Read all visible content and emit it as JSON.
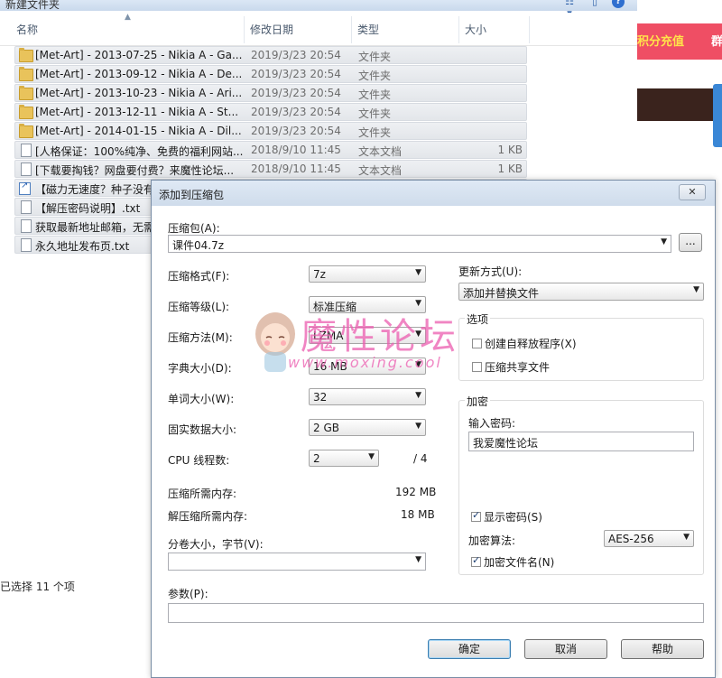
{
  "explorer": {
    "title": "新建文件夹",
    "columns": {
      "name": "名称",
      "date": "修改日期",
      "type": "类型",
      "size": "大小"
    },
    "files": [
      {
        "icon": "folder-icon",
        "name": "[Met-Art] - 2013-07-25 - Nikia A - Ga...",
        "date": "2019/3/23 20:54",
        "type": "文件夹",
        "size": ""
      },
      {
        "icon": "folder-icon",
        "name": "[Met-Art] - 2013-09-12 - Nikia A - De...",
        "date": "2019/3/23 20:54",
        "type": "文件夹",
        "size": ""
      },
      {
        "icon": "folder-icon",
        "name": "[Met-Art] - 2013-10-23 - Nikia A - Ari...",
        "date": "2019/3/23 20:54",
        "type": "文件夹",
        "size": ""
      },
      {
        "icon": "folder-icon",
        "name": "[Met-Art] - 2013-12-11 - Nikia A - St...",
        "date": "2019/3/23 20:54",
        "type": "文件夹",
        "size": ""
      },
      {
        "icon": "folder-icon",
        "name": "[Met-Art] - 2014-01-15 - Nikia A - Dil...",
        "date": "2019/3/23 20:54",
        "type": "文件夹",
        "size": ""
      },
      {
        "icon": "text-file-icon",
        "name": "[人格保证：100%纯净、免费的福利网站...",
        "date": "2018/9/10 11:45",
        "type": "文本文档",
        "size": "1 KB"
      },
      {
        "icon": "text-file-icon",
        "name": "[下载要掏钱？网盘要付费？来魔性论坛...",
        "date": "2018/9/10 11:45",
        "type": "文本文档",
        "size": "1 KB"
      },
      {
        "icon": "shortcut-icon",
        "name": "【磁力无速度？种子没有",
        "date": "",
        "type": "",
        "size": ""
      },
      {
        "icon": "text-file-icon",
        "name": "【解压密码说明】.txt",
        "date": "",
        "type": "",
        "size": ""
      },
      {
        "icon": "text-file-icon",
        "name": "获取最新地址邮箱，无需",
        "date": "",
        "type": "",
        "size": ""
      },
      {
        "icon": "text-file-icon",
        "name": "永久地址发布页.txt",
        "date": "",
        "type": "",
        "size": ""
      }
    ],
    "status": "已选择 11 个项"
  },
  "browser": {
    "banner_text": "积分充值",
    "banner_text2": "群"
  },
  "dialog": {
    "title": "添加到压缩包",
    "close": "✕",
    "archive_label": "压缩包(A):",
    "archive_value": "课件04.7z",
    "browse_label": "...",
    "format_label": "压缩格式(F):",
    "format_value": "7z",
    "level_label": "压缩等级(L):",
    "level_value": "标准压缩",
    "method_label": "压缩方法(M):",
    "method_value": "LZMA",
    "dict_label": "字典大小(D):",
    "dict_value": "16 MB",
    "word_label": "单词大小(W):",
    "word_value": "32",
    "solid_label": "固实数据大小:",
    "solid_value": "2 GB",
    "cpu_label": "CPU 线程数:",
    "cpu_value": "2",
    "cpu_total": "/ 4",
    "mem_comp_label": "压缩所需内存:",
    "mem_comp_value": "192 MB",
    "mem_decomp_label": "解压缩所需内存:",
    "mem_decomp_value": "18 MB",
    "volume_label": "分卷大小，字节(V):",
    "volume_value": "",
    "params_label": "参数(P):",
    "params_value": "",
    "update_label": "更新方式(U):",
    "update_value": "添加并替换文件",
    "options_group": "选项",
    "opt_sfx": "创建自释放程序(X)",
    "opt_sfx_checked": false,
    "opt_shared": "压缩共享文件",
    "opt_shared_checked": false,
    "encrypt_group": "加密",
    "password_label": "输入密码:",
    "password_value": "我爱魔性论坛",
    "show_password": "显示密码(S)",
    "show_password_checked": true,
    "algo_label": "加密算法:",
    "algo_value": "AES-256",
    "encrypt_names": "加密文件名(N)",
    "encrypt_names_checked": true,
    "ok": "确定",
    "cancel": "取消",
    "help": "帮助"
  },
  "watermark": {
    "text_large": "魔性论坛",
    "text_small": "www.moxing.cool"
  },
  "colors": {
    "accent_pink": "#ef4e64",
    "watermark_pink": "#eb5caf",
    "dialog_bg": "#f0f0f0"
  }
}
